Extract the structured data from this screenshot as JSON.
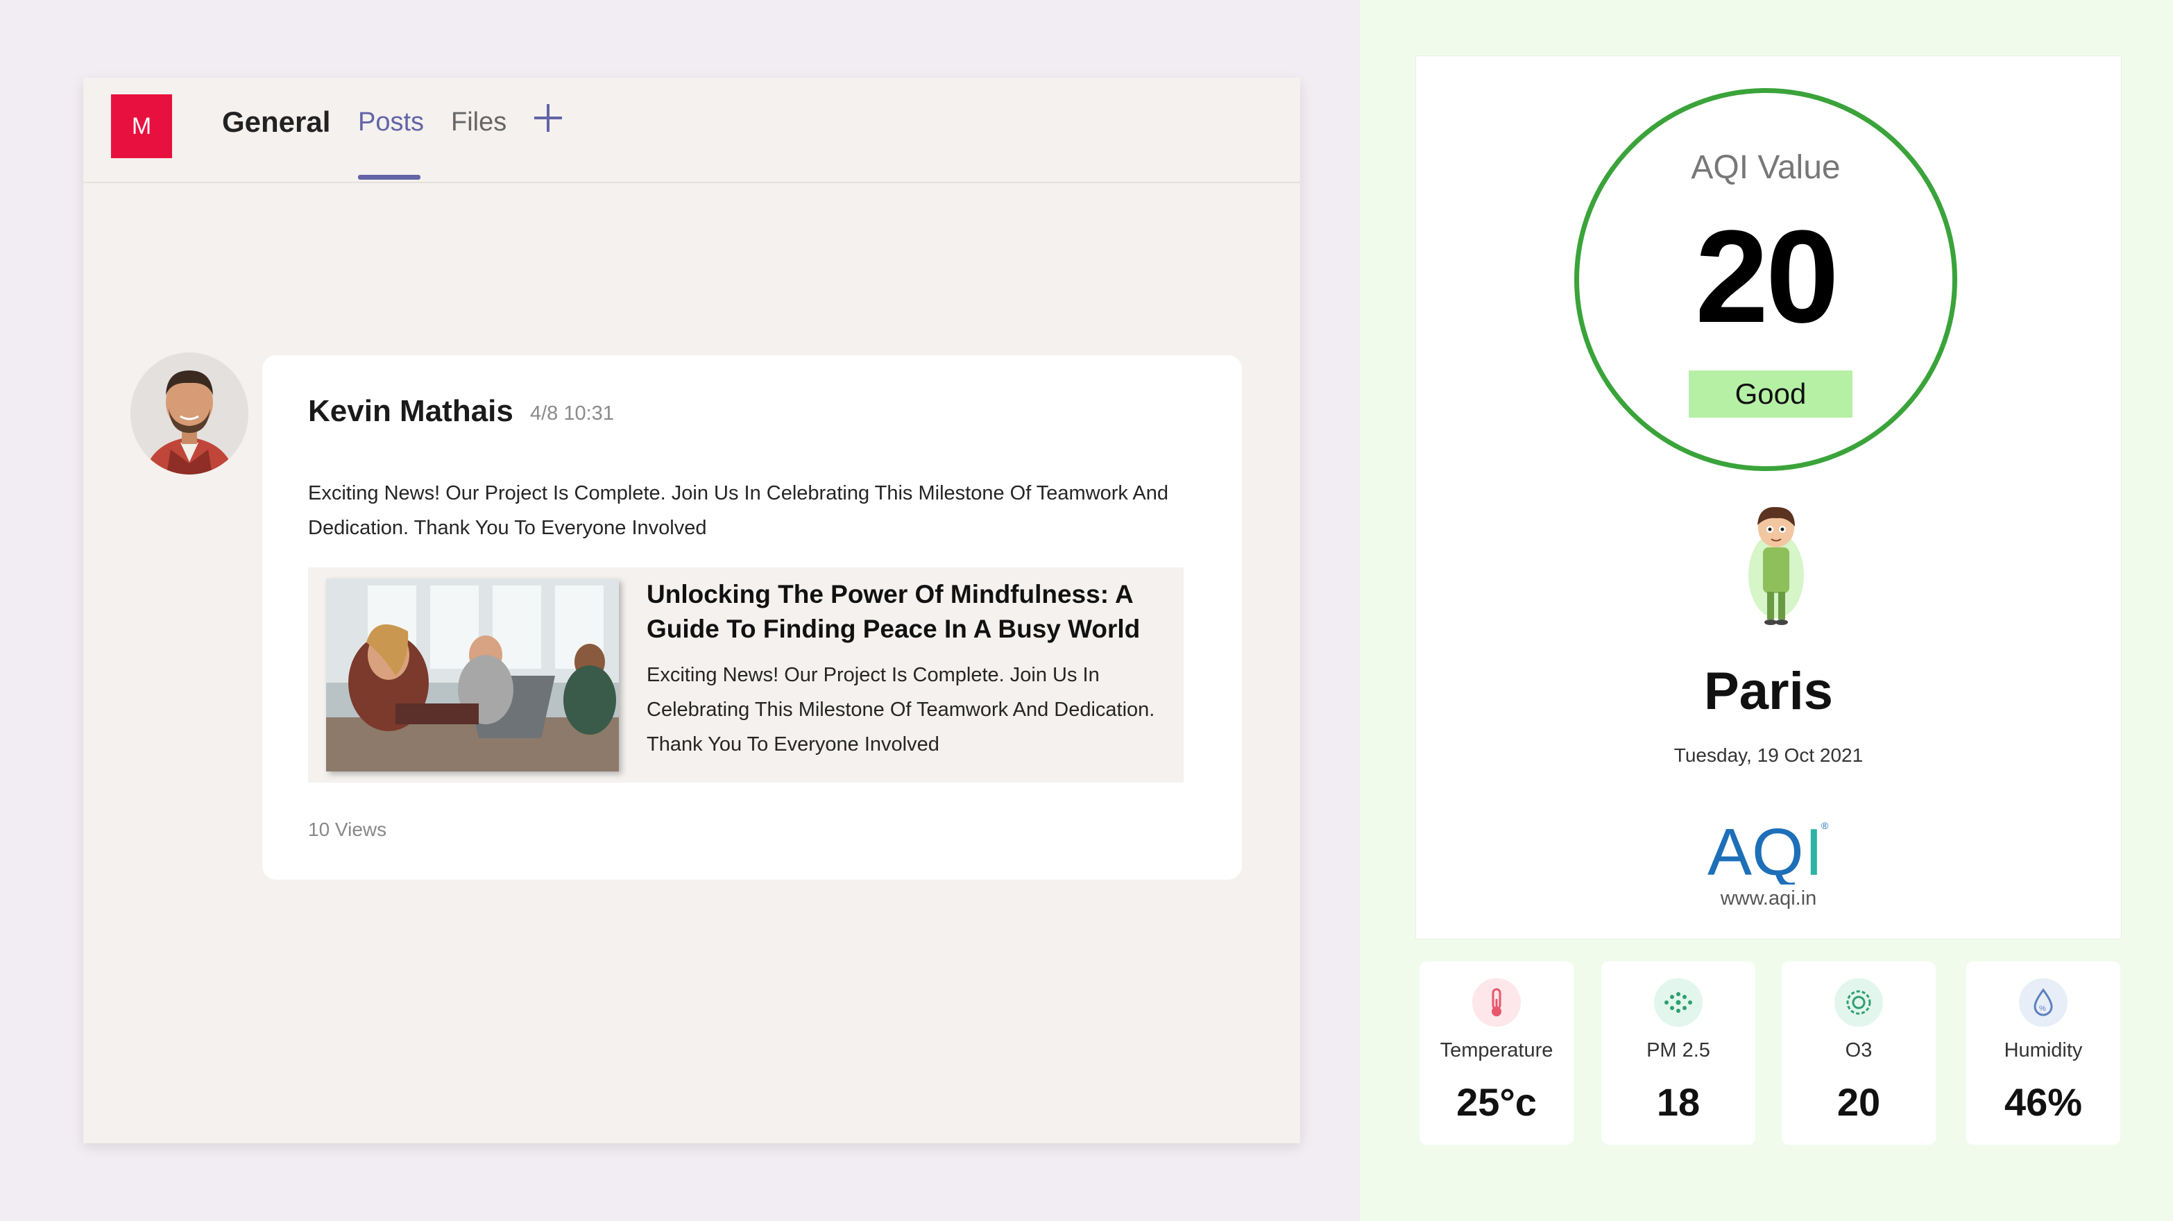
{
  "teams": {
    "team_initial": "M",
    "channel": "General",
    "tabs": [
      "Posts",
      "Files"
    ],
    "post": {
      "author": "Kevin Mathais",
      "time": "4/8 10:31",
      "text": "Exciting News! Our Project Is Complete. Join Us In Celebrating This Milestone Of Teamwork And Dedication. Thank You To Everyone Involved",
      "link_title": "Unlocking The Power Of Mindfulness: A Guide To Finding Peace In A Busy World",
      "link_description": "Exciting News! Our Project Is Complete. Join Us In Celebrating This Milestone Of Teamwork And Dedication. Thank You To Everyone Involved",
      "views": "10 Views"
    }
  },
  "aqi": {
    "label": "AQI Value",
    "value": "20",
    "status": "Good",
    "city": "Paris",
    "date": "Tuesday, 19 Oct 2021",
    "logo_text": "AQI",
    "site": "www.aqi.in",
    "metrics": [
      {
        "name": "Temperature",
        "value": "25°c",
        "icon": "thermometer-icon"
      },
      {
        "name": "PM 2.5",
        "value": "18",
        "icon": "particles-icon"
      },
      {
        "name": "O3",
        "value": "20",
        "icon": "ozone-icon"
      },
      {
        "name": "Humidity",
        "value": "46%",
        "icon": "humidity-icon"
      }
    ]
  },
  "colors": {
    "accent": "#6264a7",
    "team_avatar": "#e8103f",
    "aqi_ring": "#3aa33a",
    "status_good": "#b6f0a5"
  }
}
